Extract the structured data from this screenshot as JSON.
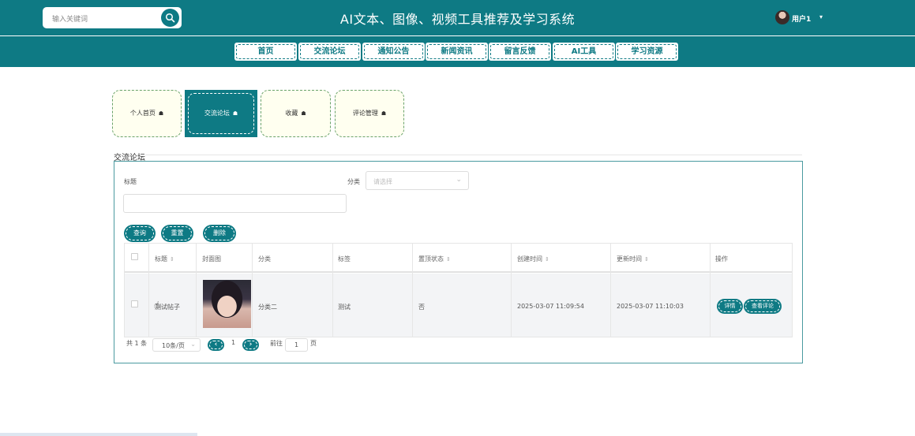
{
  "header": {
    "search_placeholder": "输入关键词",
    "site_title": "AI文本、图像、视频工具推荐及学习系统",
    "username": "用户1",
    "user_caret": "▾"
  },
  "nav": [
    {
      "label": "首页"
    },
    {
      "label": "交流论坛"
    },
    {
      "label": "通知公告"
    },
    {
      "label": "新闻资讯"
    },
    {
      "label": "留言反馈"
    },
    {
      "label": "AI工具"
    },
    {
      "label": "学习资源"
    }
  ],
  "cards": [
    {
      "label": "个人首页"
    },
    {
      "label": "交流论坛"
    },
    {
      "label": "收藏"
    },
    {
      "label": "评论管理"
    }
  ],
  "section": {
    "title": "交流论坛",
    "filter_title_label": "标题",
    "filter_category_label": "分类",
    "category_placeholder": "请选择",
    "title_value": ""
  },
  "actions": {
    "query": "查询",
    "reset": "重置",
    "delete": "删除"
  },
  "table": {
    "headers": [
      "标题",
      "封面图",
      "分类",
      "标签",
      "置顶状态",
      "创建时间",
      "更新时间",
      "操作"
    ],
    "rows": [
      {
        "title": "测试帖子",
        "category": "分类二",
        "tag": "测试",
        "pinned": "否",
        "created": "2025-03-07 11:09:54",
        "updated": "2025-03-07 11:10:03",
        "detail_btn": "详情",
        "comments_btn": "查看评论"
      }
    ]
  },
  "pagination": {
    "total": "共 1 条",
    "page_size": "10条/页",
    "current_page": "1",
    "goto_label": "前往",
    "goto_value": "1",
    "page_unit": "页"
  },
  "colors": {
    "primary": "#0e7a84",
    "card_bg": "#fffff0",
    "row_bg": "#f3f4f6"
  },
  "icons": {
    "search": "search-icon",
    "home": "home-icon",
    "prev": "chevron-left-icon",
    "next": "chevron-right-icon"
  }
}
